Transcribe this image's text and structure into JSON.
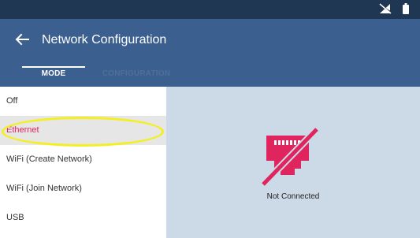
{
  "status_bar": {
    "icons": [
      "no-signal-icon",
      "battery-icon"
    ]
  },
  "app_bar": {
    "title": "Network Configuration",
    "back_icon": "arrow-left-icon",
    "color": "#3b5f8f"
  },
  "tabs": [
    {
      "label": "MODE",
      "active": true
    },
    {
      "label": "CONFIGURATION",
      "active": false
    }
  ],
  "modes": [
    {
      "label": "Off",
      "selected": false
    },
    {
      "label": "Ethernet",
      "selected": true
    },
    {
      "label": "WiFi (Create Network)",
      "selected": false
    },
    {
      "label": "WiFi (Join Network)",
      "selected": false
    },
    {
      "label": "USB",
      "selected": false
    }
  ],
  "detail": {
    "status_icon": "ethernet-disconnected-icon",
    "status_text": "Not Connected",
    "icon_color": "#e0245e",
    "background": "#ccd9e6"
  },
  "annotation": {
    "highlight_color": "#f4ef1f"
  }
}
